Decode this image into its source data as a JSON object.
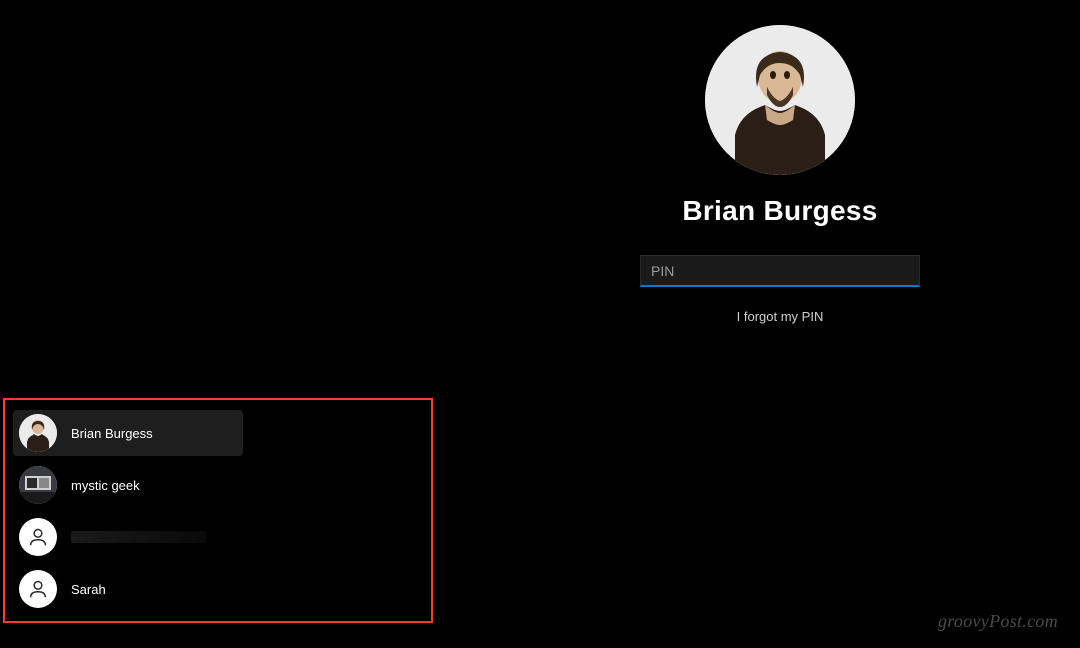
{
  "login": {
    "user_name": "Brian Burgess",
    "pin_placeholder": "PIN",
    "forgot_link": "I forgot my PIN"
  },
  "user_list": [
    {
      "label": "Brian Burgess",
      "avatar_type": "photo-1",
      "selected": true
    },
    {
      "label": "mystic geek",
      "avatar_type": "photo-2",
      "selected": false
    },
    {
      "label": "",
      "avatar_type": "generic",
      "selected": false,
      "redacted": true
    },
    {
      "label": "Sarah",
      "avatar_type": "generic",
      "selected": false
    }
  ],
  "watermark": "groovyPost.com",
  "colors": {
    "accent": "#0078d4",
    "highlight_border": "#ff3b30",
    "background": "#000000"
  }
}
